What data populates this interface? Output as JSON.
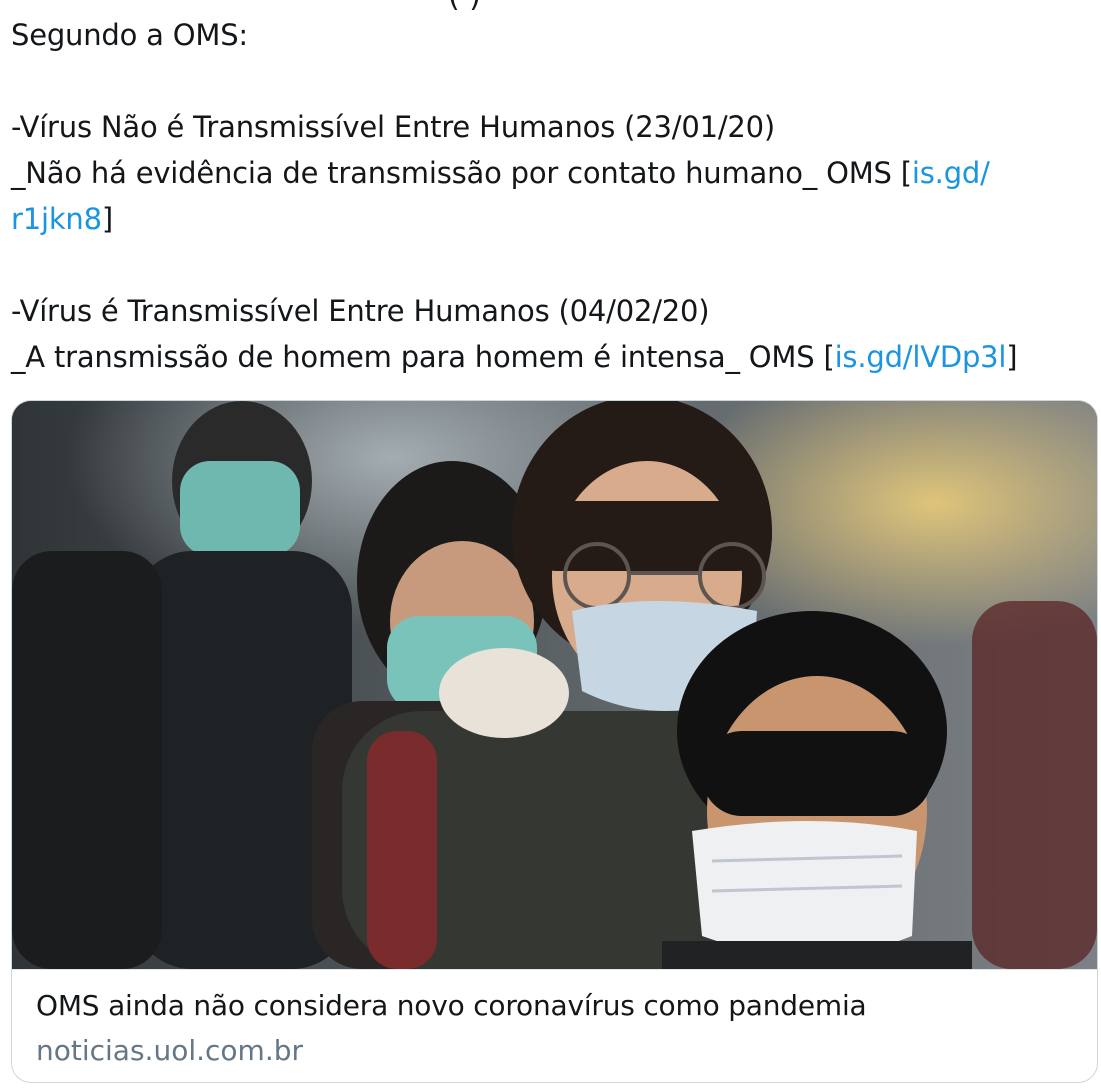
{
  "tweet": {
    "lines": [
      {
        "text": "Segundo a OMS:"
      },
      {
        "text": "-Vírus Não é Transmissível Entre Humanos (23/01/20)"
      },
      {
        "text": "_Não há evidência de transmissão por contato humano_ OMS [",
        "link": "is.gd/"
      },
      {
        "link": "r1jkn8",
        "after": "]"
      },
      {
        "text": "-Vírus é Transmissível Entre Humanos (04/02/20)"
      },
      {
        "text": "_A transmissão de homem para homem é intensa_ OMS [",
        "link": "is.gd/lVDp3l",
        "after": "]"
      }
    ]
  },
  "card": {
    "title": "OMS ainda não considera novo coronavírus como pandemia",
    "domain": "noticias.uol.com.br"
  },
  "colors": {
    "link": "#1b95e0",
    "text": "#14171a",
    "muted": "#657786",
    "border": "#ccd6dd"
  }
}
